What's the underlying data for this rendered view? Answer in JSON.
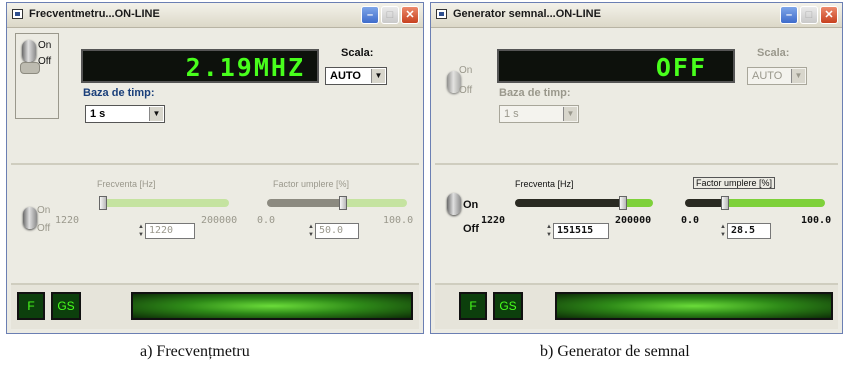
{
  "left": {
    "title": "Frecventmetru...ON-LINE",
    "switch_on": "On",
    "switch_off": "Off",
    "display": "2.19MHZ",
    "scale_label": "Scala:",
    "scale_value": "AUTO",
    "timebase_label": "Baza de timp:",
    "timebase_value": "1 s",
    "gen_on": "On",
    "gen_off": "Off",
    "freq_label": "Frecventa [Hz]",
    "freq_min": "1220",
    "freq_max": "200000",
    "freq_value": "1220",
    "duty_label": "Factor umplere [%]",
    "duty_min": "0.0",
    "duty_max": "100.0",
    "duty_value": "50.0",
    "btn_f": "F",
    "btn_gs": "GS",
    "caption": "a) Frecvențmetru"
  },
  "right": {
    "title": "Generator semnal...ON-LINE",
    "switch_on": "On",
    "switch_off": "Off",
    "display": "OFF",
    "scale_label": "Scala:",
    "scale_value": "AUTO",
    "timebase_label": "Baza de timp:",
    "timebase_value": "1 s",
    "gen_on": "On",
    "gen_off": "Off",
    "freq_label": "Frecventa [Hz]",
    "freq_min": "1220",
    "freq_max": "200000",
    "freq_value": "151515",
    "duty_label": "Factor umplere [%]",
    "duty_min": "0.0",
    "duty_max": "100.0",
    "duty_value": "28.5",
    "btn_f": "F",
    "btn_gs": "GS",
    "caption": "b) Generator de semnal"
  },
  "colors": {
    "lcd_green": "#48ff1c",
    "slider_green": "#7ed13a",
    "slider_dark": "#2a2a22"
  }
}
